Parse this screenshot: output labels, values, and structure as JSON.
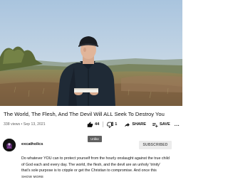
{
  "video": {
    "title": "The World, The Flesh, And The Devil Will ALL Seek To Destroy You",
    "views": "338 views",
    "date": "Sep 13, 2021"
  },
  "actions": {
    "like_count": "44",
    "dislike_count": "1",
    "share_label": "SHARE",
    "save_label": "SAVE",
    "more_label": "..."
  },
  "tooltip": {
    "text": "Unlike"
  },
  "channel": {
    "name": "excatholics",
    "subscribe_label": "SUBSCRIBED"
  },
  "description": {
    "lines": [
      "Do whatever YOU can to protect yourself from the hourly onslaught against the true child",
      "of God each and every day. The world, the flesh, and the devil are an unholy 'trinity'",
      "that's sole purpose is to cripple or get the Christian to compromise. And once this"
    ],
    "show_more_label": "SHOW MORE"
  },
  "colors": {
    "sky": "#b9d0e4",
    "hill": "#7d8a52",
    "heather": "#9a7a52",
    "jacket": "#1d2733",
    "subscribed_bg": "#ececec",
    "meta_text": "#606060"
  }
}
